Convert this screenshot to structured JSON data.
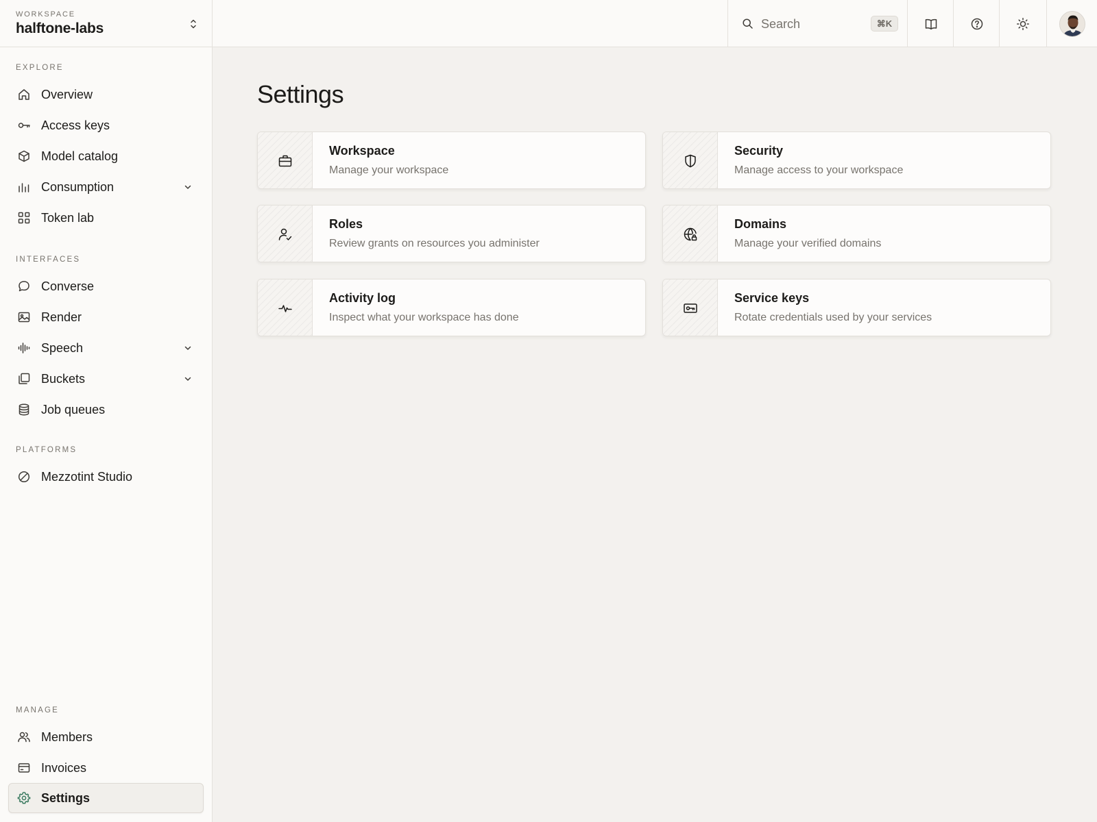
{
  "workspace": {
    "label": "WORKSPACE",
    "name": "halftone-labs"
  },
  "sidebar": {
    "sections": {
      "explore": "EXPLORE",
      "interfaces": "INTERFACES",
      "platforms": "PLATFORMS",
      "manage": "MANAGE"
    },
    "explore": [
      {
        "label": "Overview",
        "icon": "home-icon"
      },
      {
        "label": "Access keys",
        "icon": "key-icon"
      },
      {
        "label": "Model catalog",
        "icon": "cube-icon"
      },
      {
        "label": "Consumption",
        "icon": "bar-chart-icon",
        "expandable": true
      },
      {
        "label": "Token lab",
        "icon": "grid-icon"
      }
    ],
    "interfaces": [
      {
        "label": "Converse",
        "icon": "chat-bubble-icon"
      },
      {
        "label": "Render",
        "icon": "image-icon"
      },
      {
        "label": "Speech",
        "icon": "audio-wave-icon",
        "expandable": true
      },
      {
        "label": "Buckets",
        "icon": "stack-icon",
        "expandable": true
      },
      {
        "label": "Job queues",
        "icon": "database-icon"
      }
    ],
    "platforms": [
      {
        "label": "Mezzotint Studio",
        "icon": "slashed-circle-icon"
      }
    ],
    "manage": [
      {
        "label": "Members",
        "icon": "users-icon"
      },
      {
        "label": "Invoices",
        "icon": "credit-card-icon"
      },
      {
        "label": "Settings",
        "icon": "gear-icon",
        "active": true
      }
    ]
  },
  "topbar": {
    "search": {
      "placeholder": "Search",
      "shortcut": "⌘K"
    },
    "buttons": [
      {
        "name": "docs",
        "icon": "book-icon"
      },
      {
        "name": "help",
        "icon": "help-circle-icon"
      },
      {
        "name": "theme",
        "icon": "sun-icon"
      }
    ],
    "avatar_icon": "user-avatar"
  },
  "main": {
    "title": "Settings",
    "cards": [
      {
        "title": "Workspace",
        "description": "Manage your workspace",
        "icon": "briefcase-icon"
      },
      {
        "title": "Security",
        "description": "Manage access to your workspace",
        "icon": "shield-icon"
      },
      {
        "title": "Roles",
        "description": "Review grants on resources you administer",
        "icon": "user-check-icon"
      },
      {
        "title": "Domains",
        "description": "Manage your verified domains",
        "icon": "globe-lock-icon"
      },
      {
        "title": "Activity log",
        "description": "Inspect what your workspace has done",
        "icon": "activity-icon"
      },
      {
        "title": "Service keys",
        "description": "Rotate credentials used by your services",
        "icon": "key-card-icon"
      }
    ]
  },
  "colors": {
    "background": "#f3f1ee",
    "surface": "#fbfaf8",
    "border": "#e4e1dc",
    "text": "#1c1b19",
    "muted": "#77736d",
    "active_icon": "#3b7a60"
  }
}
